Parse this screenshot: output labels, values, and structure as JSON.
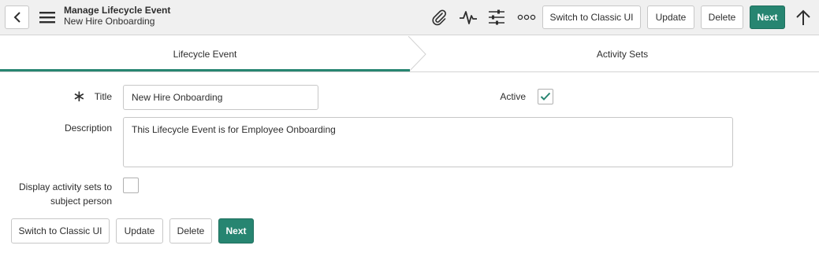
{
  "header": {
    "title": "Manage Lifecycle Event",
    "subtitle": "New Hire Onboarding",
    "buttons": {
      "switch_classic": "Switch to Classic UI",
      "update": "Update",
      "delete": "Delete",
      "next": "Next"
    },
    "icons": [
      "back-icon",
      "hamburger-menu-icon",
      "paperclip-icon",
      "activity-icon",
      "sliders-icon",
      "more-icon",
      "arrow-up-icon"
    ]
  },
  "tabs": [
    {
      "label": "Lifecycle Event",
      "active": true
    },
    {
      "label": "Activity Sets",
      "active": false
    }
  ],
  "form": {
    "title_label": "Title",
    "title_value": "New Hire Onboarding",
    "active_label": "Active",
    "active_checked": true,
    "description_label": "Description",
    "description_value": "This Lifecycle Event is for Employee Onboarding",
    "display_label_line1": "Display activity sets to",
    "display_label_line2": "subject person",
    "display_checked": false
  },
  "footer": {
    "switch_classic": "Switch to Classic UI",
    "update": "Update",
    "delete": "Delete",
    "next": "Next"
  },
  "colors": {
    "accent": "#278571",
    "header_bg": "#f0f0f0"
  }
}
